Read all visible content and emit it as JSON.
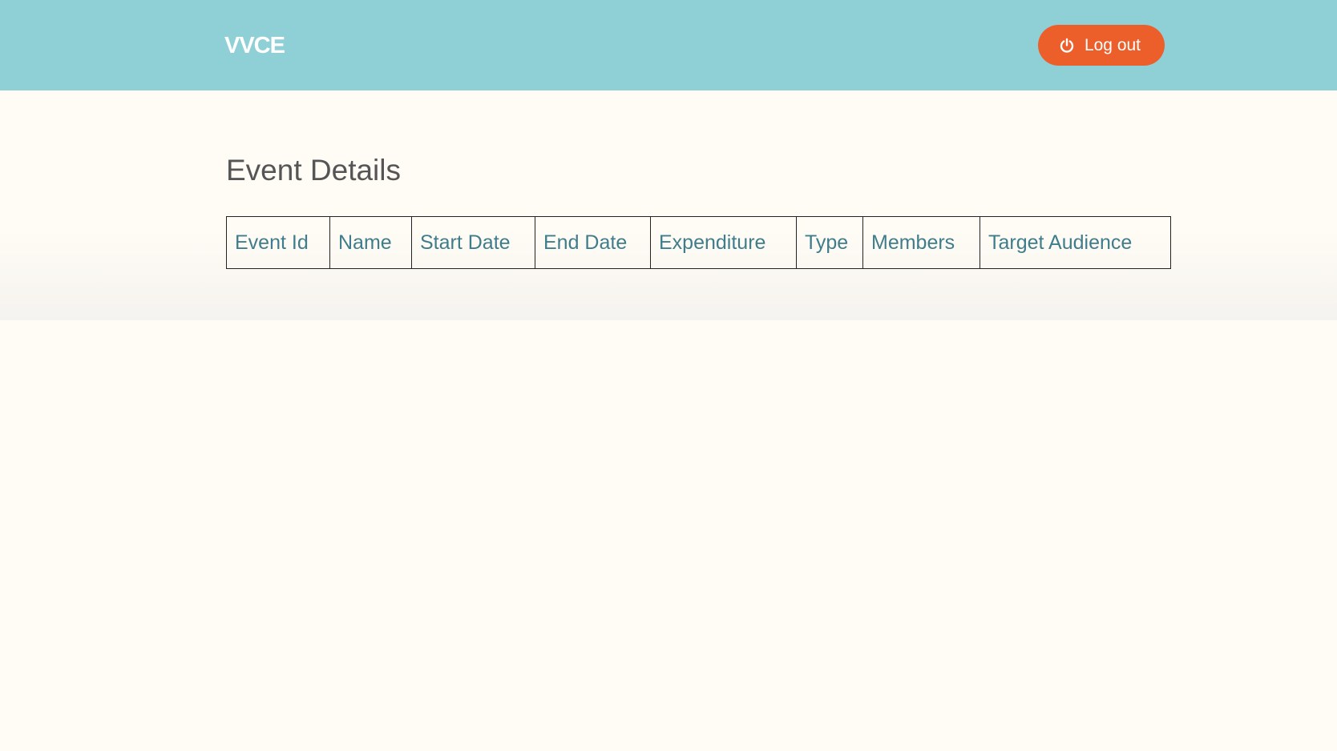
{
  "header": {
    "brand": "VVCE",
    "logout_label": "Log out",
    "logout_icon": "power-icon"
  },
  "main": {
    "title": "Event Details",
    "table": {
      "columns": [
        "Event Id",
        "Name",
        "Start Date",
        "End Date",
        "Expenditure",
        "Type",
        "Members",
        "Target Audience"
      ],
      "rows": []
    }
  },
  "colors": {
    "header_bg": "#8fd0d6",
    "accent_button": "#ec5f2b",
    "page_bg": "#fffcf5",
    "table_header_text": "#3f7d8c",
    "title_text": "#555555"
  }
}
